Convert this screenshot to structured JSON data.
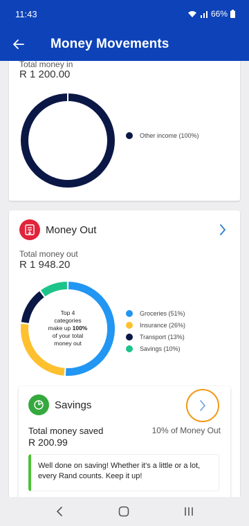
{
  "status": {
    "time": "11:43",
    "battery": "66%"
  },
  "app_bar": {
    "title": "Money Movements"
  },
  "money_in": {
    "label": "Total money in",
    "amount": "R 1 200.00",
    "legend": [
      {
        "label": "Other income (100%)",
        "color": "#0b1846",
        "value": 100
      }
    ]
  },
  "money_out": {
    "title": "Money Out",
    "label": "Total money out",
    "amount": "R 1 948.20",
    "center_line1": "Top 4",
    "center_line2": "categories",
    "center_line3_pre": "make up ",
    "center_line3_bold": "100%",
    "center_line4": "of your total",
    "center_line5": "money out",
    "legend": [
      {
        "label": "Groceries (51%)",
        "color": "#2196f3",
        "value": 51
      },
      {
        "label": "Insurance (26%)",
        "color": "#fec02f",
        "value": 26
      },
      {
        "label": "Transport (13%)",
        "color": "#0b1846",
        "value": 13
      },
      {
        "label": "Savings (10%)",
        "color": "#1cc48a",
        "value": 10
      }
    ]
  },
  "savings": {
    "title": "Savings",
    "label": "Total money saved",
    "amount": "R 200.99",
    "share": "10% of Money Out",
    "tip": "Well done on saving! Whether it's a little or a lot, every Rand counts. Keep it up!"
  }
}
